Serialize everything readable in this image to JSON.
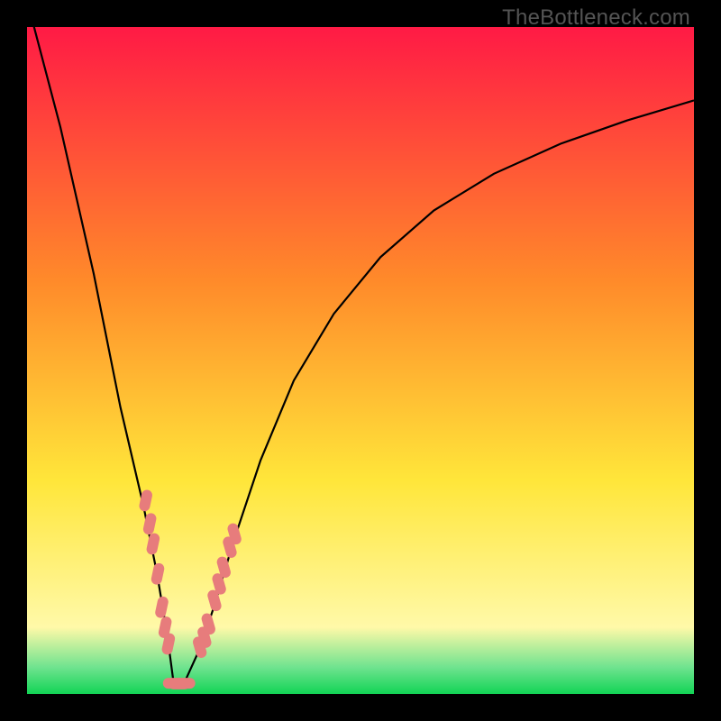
{
  "watermark": "TheBottleneck.com",
  "colors": {
    "black": "#000000",
    "curve": "#000000",
    "marker_fill": "#e77c7c",
    "marker_stroke": "#c46060",
    "grad_top": "#ff1a45",
    "grad_mid1": "#ff8a2a",
    "grad_mid2": "#ffe63a",
    "grad_low": "#fff9a8",
    "grad_green1": "#6fe38f",
    "grad_green2": "#12d455"
  },
  "chart_data": {
    "type": "line",
    "title": "",
    "xlabel": "",
    "ylabel": "",
    "xlim": [
      0,
      100
    ],
    "ylim": [
      0,
      100
    ],
    "series": [
      {
        "name": "bottleneck-curve",
        "x": [
          0,
          5,
          10,
          14,
          17.5,
          19.5,
          21,
          22,
          23.5,
          26,
          28,
          31,
          35,
          40,
          46,
          53,
          61,
          70,
          80,
          90,
          100
        ],
        "y": [
          104,
          85,
          63,
          43,
          28,
          18,
          9,
          1.5,
          1.5,
          7,
          13,
          23,
          35,
          47,
          57,
          65.5,
          72.5,
          78,
          82.5,
          86,
          89
        ]
      }
    ],
    "marker_clusters": [
      {
        "name": "left-cluster",
        "points": [
          {
            "x": 17.8,
            "y": 29.0
          },
          {
            "x": 18.4,
            "y": 25.5
          },
          {
            "x": 18.9,
            "y": 22.5
          },
          {
            "x": 19.6,
            "y": 18.0
          },
          {
            "x": 20.2,
            "y": 13.0
          },
          {
            "x": 20.7,
            "y": 10.0
          },
          {
            "x": 21.2,
            "y": 7.5
          }
        ]
      },
      {
        "name": "bottom-cluster",
        "points": [
          {
            "x": 22.0,
            "y": 1.6
          },
          {
            "x": 22.8,
            "y": 1.5
          },
          {
            "x": 23.6,
            "y": 1.6
          }
        ]
      },
      {
        "name": "right-cluster",
        "points": [
          {
            "x": 25.9,
            "y": 7.0
          },
          {
            "x": 26.6,
            "y": 8.5
          },
          {
            "x": 27.2,
            "y": 10.5
          },
          {
            "x": 28.1,
            "y": 14.0
          },
          {
            "x": 28.8,
            "y": 16.5
          },
          {
            "x": 29.5,
            "y": 19.0
          },
          {
            "x": 30.4,
            "y": 22.0
          },
          {
            "x": 31.1,
            "y": 24.0
          }
        ]
      }
    ]
  }
}
